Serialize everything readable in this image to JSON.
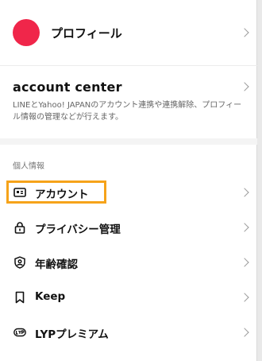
{
  "profile": {
    "label": "プロフィール",
    "avatar_color": "#f0264a"
  },
  "account_center": {
    "title": "account center",
    "description": "LINEとYahoo! JAPANのアカウント連携や連携解除、プロフィール情報の管理などが行えます。"
  },
  "section": {
    "label": "個人情報"
  },
  "menu": [
    {
      "label": "アカウント",
      "icon": "id-card-icon"
    },
    {
      "label": "プライバシー管理",
      "icon": "lock-icon"
    },
    {
      "label": "年齢確認",
      "icon": "shield-person-icon"
    },
    {
      "label": "Keep",
      "icon": "bookmark-icon"
    },
    {
      "label": "LYPプレミアム",
      "icon": "lyp-badge-icon"
    }
  ],
  "highlight_color": "#f6a31a"
}
